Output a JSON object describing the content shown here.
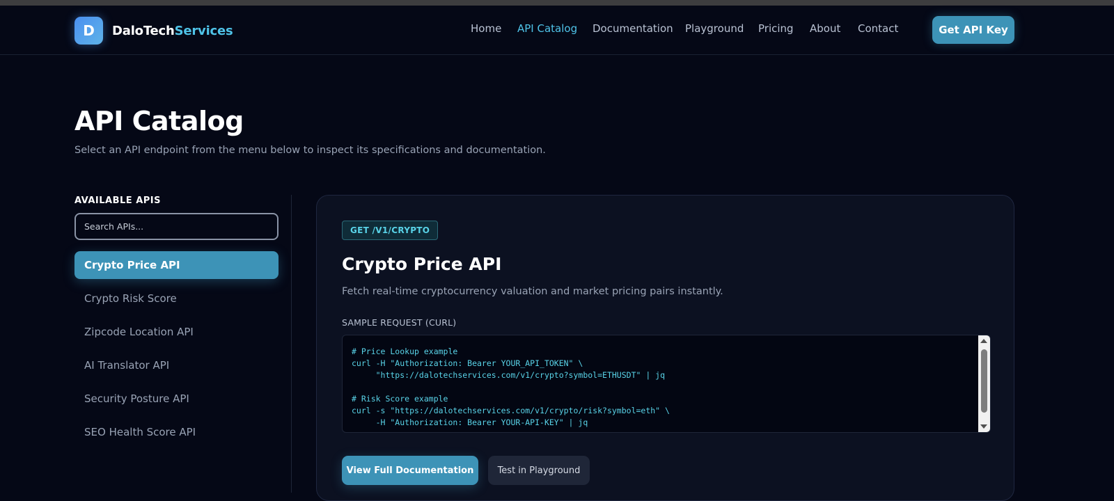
{
  "header": {
    "logo_letter": "D",
    "brand_primary": "DaloTech",
    "brand_accent": "Services",
    "nav": [
      {
        "label": "Home",
        "active": false
      },
      {
        "label": "API Catalog",
        "active": true
      },
      {
        "label": "Documentation",
        "active": false
      },
      {
        "label": "Playground",
        "active": false
      },
      {
        "label": "Pricing",
        "active": false
      },
      {
        "label": "About",
        "active": false
      },
      {
        "label": "Contact",
        "active": false
      }
    ],
    "cta_label": "Get API Key"
  },
  "page": {
    "title": "API Catalog",
    "subtitle": "Select an API endpoint from the menu below to inspect its specifications and documentation."
  },
  "sidebar": {
    "heading": "AVAILABLE APIS",
    "search_placeholder": "Search APIs...",
    "items": [
      {
        "label": "Crypto Price API",
        "active": true
      },
      {
        "label": "Crypto Risk Score",
        "active": false
      },
      {
        "label": "Zipcode Location API",
        "active": false
      },
      {
        "label": "AI Translator API",
        "active": false
      },
      {
        "label": "Security Posture API",
        "active": false
      },
      {
        "label": "SEO Health Score API",
        "active": false
      }
    ]
  },
  "detail": {
    "method_badge": "GET /V1/CRYPTO",
    "title": "Crypto Price API",
    "description": "Fetch real-time cryptocurrency valuation and market pricing pairs instantly.",
    "sample_label": "SAMPLE REQUEST (CURL)",
    "code_lines": [
      "# Price Lookup example",
      "curl -H \"Authorization: Bearer YOUR_API_TOKEN\" \\",
      "     \"https://dalotechservices.com/v1/crypto?symbol=ETHUSDT\" | jq",
      "",
      "# Risk Score example",
      "curl -s \"https://dalotechservices.com/v1/crypto/risk?symbol=eth\" \\",
      "     -H \"Authorization: Bearer YOUR-API-KEY\" | jq"
    ],
    "primary_button": "View Full Documentation",
    "secondary_button": "Test in Playground"
  },
  "colors": {
    "background": "#050816",
    "accent": "#3d93b7",
    "accent_text": "#4fc3e8",
    "card": "#0c1121"
  }
}
